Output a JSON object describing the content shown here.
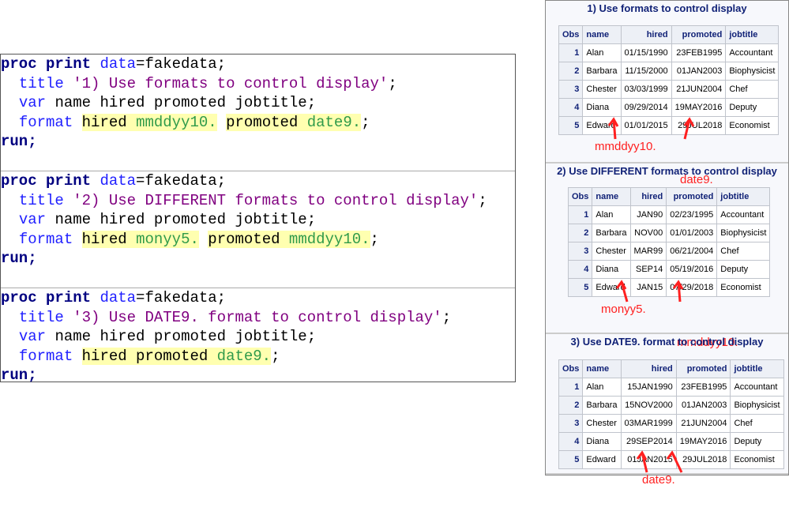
{
  "code": {
    "sections": [
      {
        "title": "'1) Use formats to control display'",
        "fmt": [
          [
            "hired",
            "mmddyy10."
          ],
          [
            "promoted",
            "date9."
          ]
        ]
      },
      {
        "title": "'2) Use DIFFERENT formats to control display'",
        "fmt": [
          [
            "hired",
            "monyy5."
          ],
          [
            "promoted",
            "mmddyy10."
          ]
        ]
      },
      {
        "title": "'3) Use DATE9. format to control display'",
        "fmt": [
          [
            "hired promoted",
            "date9."
          ]
        ]
      }
    ],
    "proc": "proc print",
    "data_kw": "data",
    "dataset": "=fakedata;",
    "title_kw": "title",
    "var_kw": "var",
    "vars": "name hired promoted jobtitle;",
    "format_kw": "format",
    "run": "run;"
  },
  "output": {
    "headers": [
      "Obs",
      "name",
      "hired",
      "promoted",
      "jobtitle"
    ],
    "names": [
      "Alan",
      "Barbara",
      "Chester",
      "Diana",
      "Edward"
    ],
    "jobs": [
      "Accountant",
      "Biophysicist",
      "Chef",
      "Deputy",
      "Economist"
    ],
    "tables": [
      {
        "title": "1) Use formats to control display",
        "hired": [
          "01/15/1990",
          "11/15/2000",
          "03/03/1999",
          "09/29/2014",
          "01/01/2015"
        ],
        "promoted": [
          "23FEB1995",
          "01JAN2003",
          "21JUN2004",
          "19MAY2016",
          "29JUL2018"
        ],
        "notes": [
          "mmddyy10.",
          "date9."
        ]
      },
      {
        "title": "2) Use DIFFERENT formats to control display",
        "hired": [
          "JAN90",
          "NOV00",
          "MAR99",
          "SEP14",
          "JAN15"
        ],
        "promoted": [
          "02/23/1995",
          "01/01/2003",
          "06/21/2004",
          "05/19/2016",
          "07/29/2018"
        ],
        "notes": [
          "monyy5.",
          "mmddyy10."
        ]
      },
      {
        "title": "3) Use DATE9. format to control display",
        "hired": [
          "15JAN1990",
          "15NOV2000",
          "03MAR1999",
          "29SEP2014",
          "01JAN2015"
        ],
        "promoted": [
          "23FEB1995",
          "01JAN2003",
          "21JUN2004",
          "19MAY2016",
          "29JUL2018"
        ],
        "notes": [
          "date9."
        ]
      }
    ]
  },
  "colors": {
    "annotation": "#ff2020",
    "highlight": "#ffffb0"
  }
}
